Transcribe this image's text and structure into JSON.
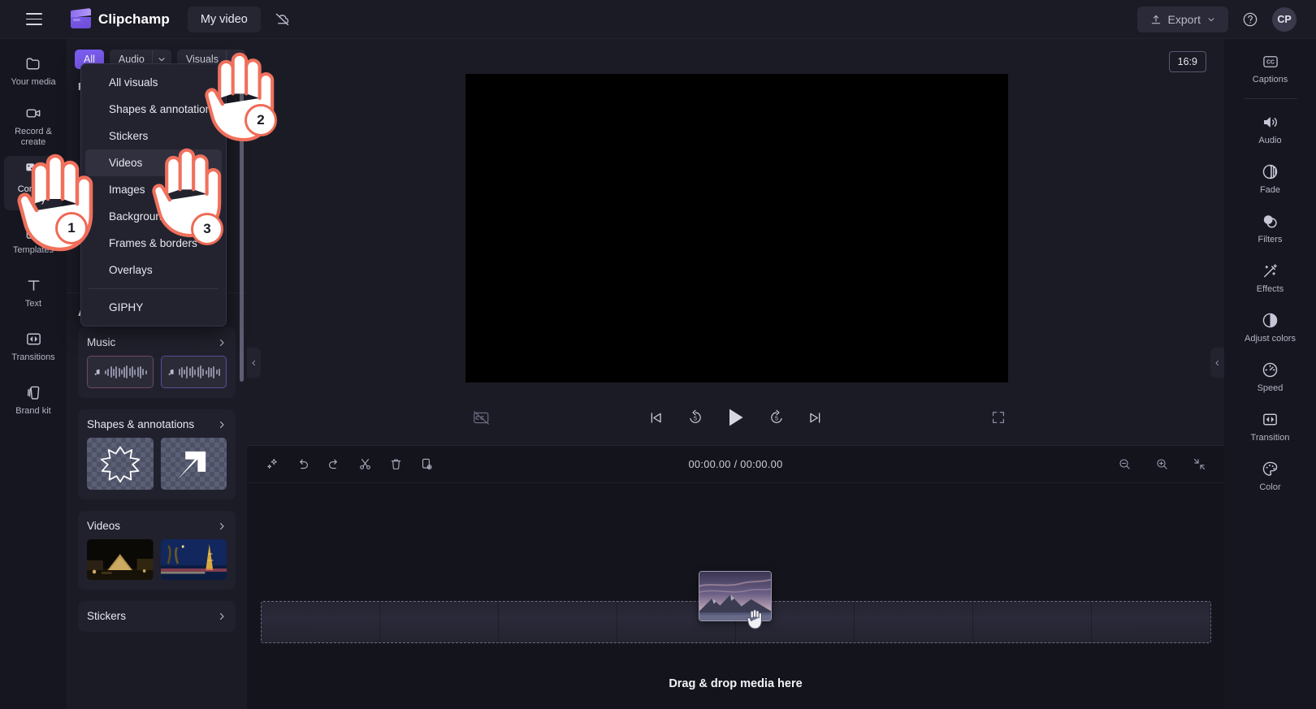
{
  "header": {
    "menu_icon": "hamburger-icon",
    "brand": "Clipchamp",
    "project_title": "My video",
    "cloud_icon": "cloud-off-icon",
    "export_label": "Export",
    "help_icon": "help-circle-icon",
    "avatar_initials": "CP"
  },
  "left_rail": [
    {
      "label": "Your media",
      "icon": "folder-icon",
      "active": false
    },
    {
      "label": "Record & create",
      "icon": "video-camera-icon",
      "active": false
    },
    {
      "label": "Content library",
      "icon": "content-library-icon",
      "active": true
    },
    {
      "label": "Templates",
      "icon": "templates-icon",
      "active": false
    },
    {
      "label": "Text",
      "icon": "text-icon",
      "active": false
    },
    {
      "label": "Transitions",
      "icon": "transitions-icon",
      "active": false
    },
    {
      "label": "Brand kit",
      "icon": "brand-kit-icon",
      "active": false
    }
  ],
  "library": {
    "filters": {
      "all": "All",
      "audio": "Audio",
      "visuals": "Visuals"
    },
    "featured_label": "F",
    "all_content_heading": "All content",
    "sections": [
      {
        "title": "Music",
        "chevron": "chevron-right-icon",
        "thumbs": [
          "music-waveform-1",
          "music-waveform-2"
        ]
      },
      {
        "title": "Shapes & annotations",
        "chevron": "chevron-right-icon",
        "thumbs": [
          "starburst-shape",
          "arrow-shape"
        ]
      },
      {
        "title": "Videos",
        "chevron": "chevron-right-icon",
        "thumbs": [
          "louvre-pyramid-night",
          "eiffel-tower-night"
        ]
      },
      {
        "title": "Stickers",
        "chevron": "chevron-right-icon",
        "thumbs": []
      }
    ]
  },
  "dropdown": {
    "items": [
      "All visuals",
      "Shapes & annotations",
      "Stickers",
      "Videos",
      "Images",
      "Backgrounds",
      "Frames & borders",
      "Overlays"
    ],
    "highlighted": "Videos",
    "footer_item": "GIPHY"
  },
  "stage": {
    "aspect_ratio": "16:9",
    "collapse_left_icon": "chevron-left-icon",
    "collapse_right_icon": "chevron-left-icon",
    "player": {
      "captions_off_icon": "captions-off-icon",
      "skip_start_icon": "skip-to-start-icon",
      "back5_icon": "rewind-5-icon",
      "play_icon": "play-icon",
      "fwd5_icon": "forward-5-icon",
      "skip_end_icon": "skip-to-end-icon",
      "fullscreen_icon": "fullscreen-icon"
    }
  },
  "timeline": {
    "tools": [
      {
        "name": "magic-sparkle-icon"
      },
      {
        "name": "undo-icon"
      },
      {
        "name": "redo-icon"
      },
      {
        "name": "split-scissors-icon"
      },
      {
        "name": "delete-trash-icon"
      },
      {
        "name": "duplicate-icon"
      }
    ],
    "current_time": "00:00.00",
    "total_time": "00:00.00",
    "time_display": "00:00.00 / 00:00.00",
    "zoom_out_icon": "zoom-out-icon",
    "zoom_in_icon": "zoom-in-icon",
    "fit_icon": "fit-to-screen-icon",
    "drop_hint": "Drag & drop media here",
    "dragging_item": "mountain-sunset-clip",
    "cursor_icon": "grabbing-hand-icon"
  },
  "right_rail": [
    {
      "label": "Captions",
      "icon": "closed-captions-icon"
    },
    {
      "label": "Audio",
      "icon": "speaker-icon"
    },
    {
      "label": "Fade",
      "icon": "fade-icon"
    },
    {
      "label": "Filters",
      "icon": "filters-icon"
    },
    {
      "label": "Effects",
      "icon": "magic-wand-icon"
    },
    {
      "label": "Adjust colors",
      "icon": "contrast-icon"
    },
    {
      "label": "Speed",
      "icon": "speedometer-icon"
    },
    {
      "label": "Transition",
      "icon": "transition-icon"
    },
    {
      "label": "Color",
      "icon": "palette-icon"
    }
  ],
  "steps": [
    {
      "number": "1",
      "target": "Content library"
    },
    {
      "number": "2",
      "target": "Visuals dropdown caret"
    },
    {
      "number": "3",
      "target": "Videos menu item"
    }
  ],
  "colors": {
    "accent": "#7a5cf0",
    "step_ring": "#ef6a55",
    "panel": "#1b1b26",
    "rail": "#161620",
    "canvas_bg": "#000000"
  }
}
